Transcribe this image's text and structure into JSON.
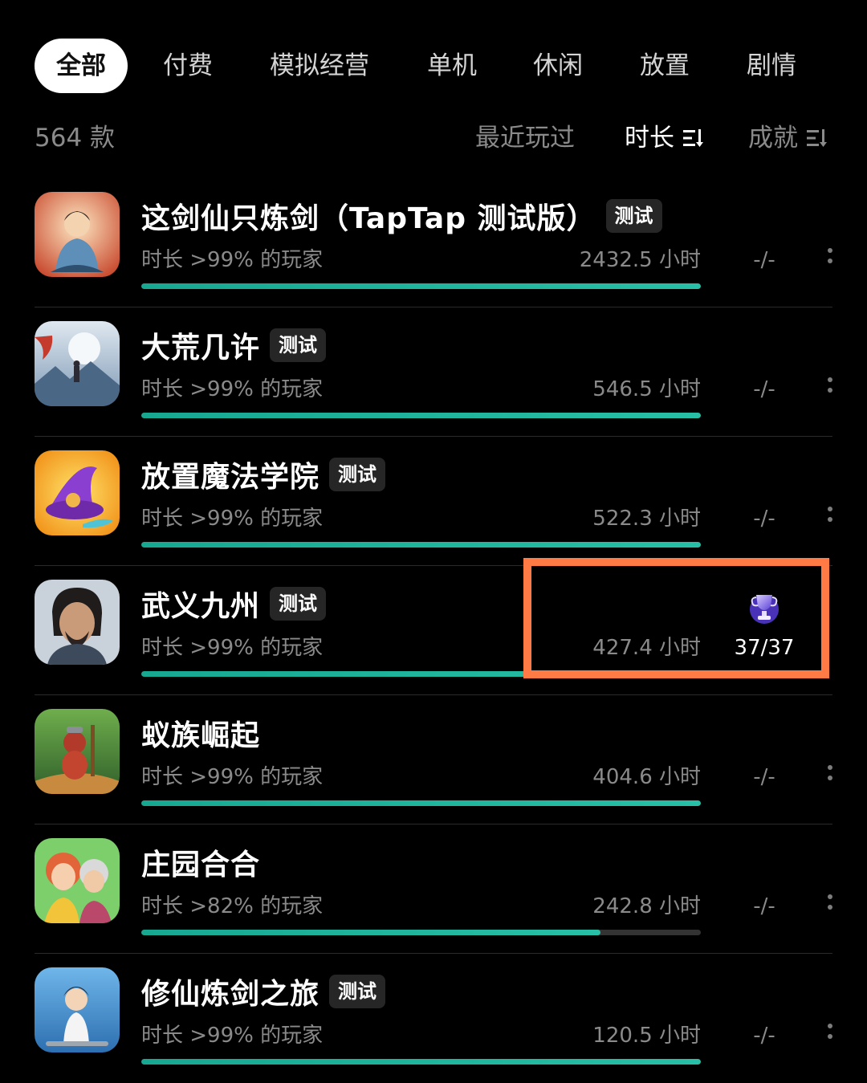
{
  "tabs": [
    {
      "label": "全部",
      "active": true
    },
    {
      "label": "付费",
      "active": false
    },
    {
      "label": "模拟经营",
      "active": false
    },
    {
      "label": "单机",
      "active": false
    },
    {
      "label": "休闲",
      "active": false
    },
    {
      "label": "放置",
      "active": false
    },
    {
      "label": "剧情",
      "active": false
    }
  ],
  "count_label": "564 款",
  "sort": {
    "recent": "最近玩过",
    "duration": "时长",
    "achievement": "成就"
  },
  "colors": {
    "accent": "#27c0a6",
    "highlight": "#ff7a45"
  },
  "games": [
    {
      "title": "这剑仙只炼剑（TapTap 测试版）",
      "badge": "测试",
      "percentile": "时长 >99% 的玩家",
      "hours": "2432.5 小时",
      "progress": 1.0,
      "achievement": "-/-",
      "icon": "cultivator-meditating-icon"
    },
    {
      "title": "大荒几许",
      "badge": "测试",
      "percentile": "时长 >99% 的玩家",
      "hours": "546.5 小时",
      "progress": 1.0,
      "achievement": "-/-",
      "icon": "moonlit-swordsman-icon"
    },
    {
      "title": "放置魔法学院",
      "badge": "测试",
      "percentile": "时长 >99% 的玩家",
      "hours": "522.3 小时",
      "progress": 1.0,
      "achievement": "-/-",
      "icon": "wizard-hat-icon"
    },
    {
      "title": "武义九州",
      "badge": "测试",
      "percentile": "时长 >99% 的玩家",
      "hours": "427.4 小时",
      "progress": 1.0,
      "achievement": "37/37",
      "icon": "warrior-portrait-icon",
      "trophy": "trophy-icon"
    },
    {
      "title": "蚁族崛起",
      "badge": "",
      "percentile": "时长 >99% 的玩家",
      "hours": "404.6 小时",
      "progress": 1.0,
      "achievement": "-/-",
      "icon": "ant-warrior-icon"
    },
    {
      "title": "庄园合合",
      "badge": "",
      "percentile": "时长 >82% 的玩家",
      "hours": "242.8 小时",
      "progress": 0.82,
      "achievement": "-/-",
      "icon": "garden-characters-icon"
    },
    {
      "title": "修仙炼剑之旅",
      "badge": "测试",
      "percentile": "时长 >99% 的玩家",
      "hours": "120.5 小时",
      "progress": 1.0,
      "achievement": "-/-",
      "icon": "young-cultivator-icon"
    }
  ]
}
